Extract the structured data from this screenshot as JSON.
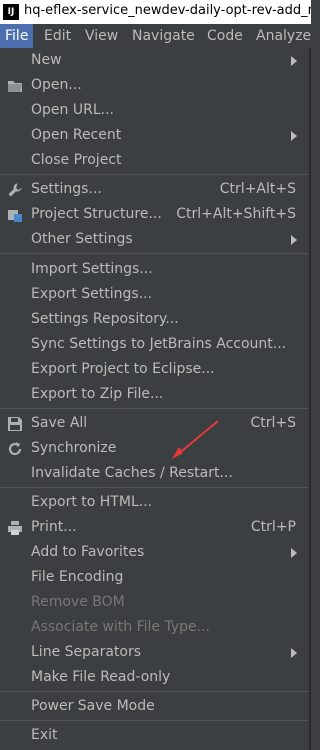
{
  "titlebar": {
    "logo": "IJ",
    "title": "hq-eflex-service_newdev-daily-opt-rev-add_risk [D"
  },
  "menubar": {
    "items": [
      "File",
      "Edit",
      "View",
      "Navigate",
      "Code",
      "Analyze"
    ],
    "active": "File"
  },
  "menu": {
    "new": "New",
    "open": "Open...",
    "open_url": "Open URL...",
    "open_recent": "Open Recent",
    "close_project": "Close Project",
    "settings": "Settings...",
    "settings_shortcut": "Ctrl+Alt+S",
    "project_structure": "Project Structure...",
    "project_structure_shortcut": "Ctrl+Alt+Shift+S",
    "other_settings": "Other Settings",
    "import_settings": "Import Settings...",
    "export_settings": "Export Settings...",
    "settings_repository": "Settings Repository...",
    "sync_settings": "Sync Settings to JetBrains Account...",
    "export_eclipse": "Export Project to Eclipse...",
    "export_zip": "Export to Zip File...",
    "save_all": "Save All",
    "save_all_shortcut": "Ctrl+S",
    "synchronize": "Synchronize",
    "invalidate_caches": "Invalidate Caches / Restart...",
    "export_html": "Export to HTML...",
    "print": "Print...",
    "print_shortcut": "Ctrl+P",
    "add_favorites": "Add to Favorites",
    "file_encoding": "File Encoding",
    "remove_bom": "Remove BOM",
    "associate_file_type": "Associate with File Type...",
    "line_separators": "Line Separators",
    "make_read_only": "Make File Read-only",
    "power_save": "Power Save Mode",
    "exit": "Exit"
  },
  "icons": {
    "open": "folder-icon",
    "settings": "wrench-icon",
    "project_structure": "project-structure-icon",
    "save_all": "save-icon",
    "synchronize": "sync-icon",
    "print": "printer-icon"
  },
  "colors": {
    "menu_bg": "#3c3f41",
    "active_menu": "#4b6eaf",
    "text": "#bbbbbb",
    "disabled_text": "#777777",
    "annotation_arrow": "#e53935"
  }
}
